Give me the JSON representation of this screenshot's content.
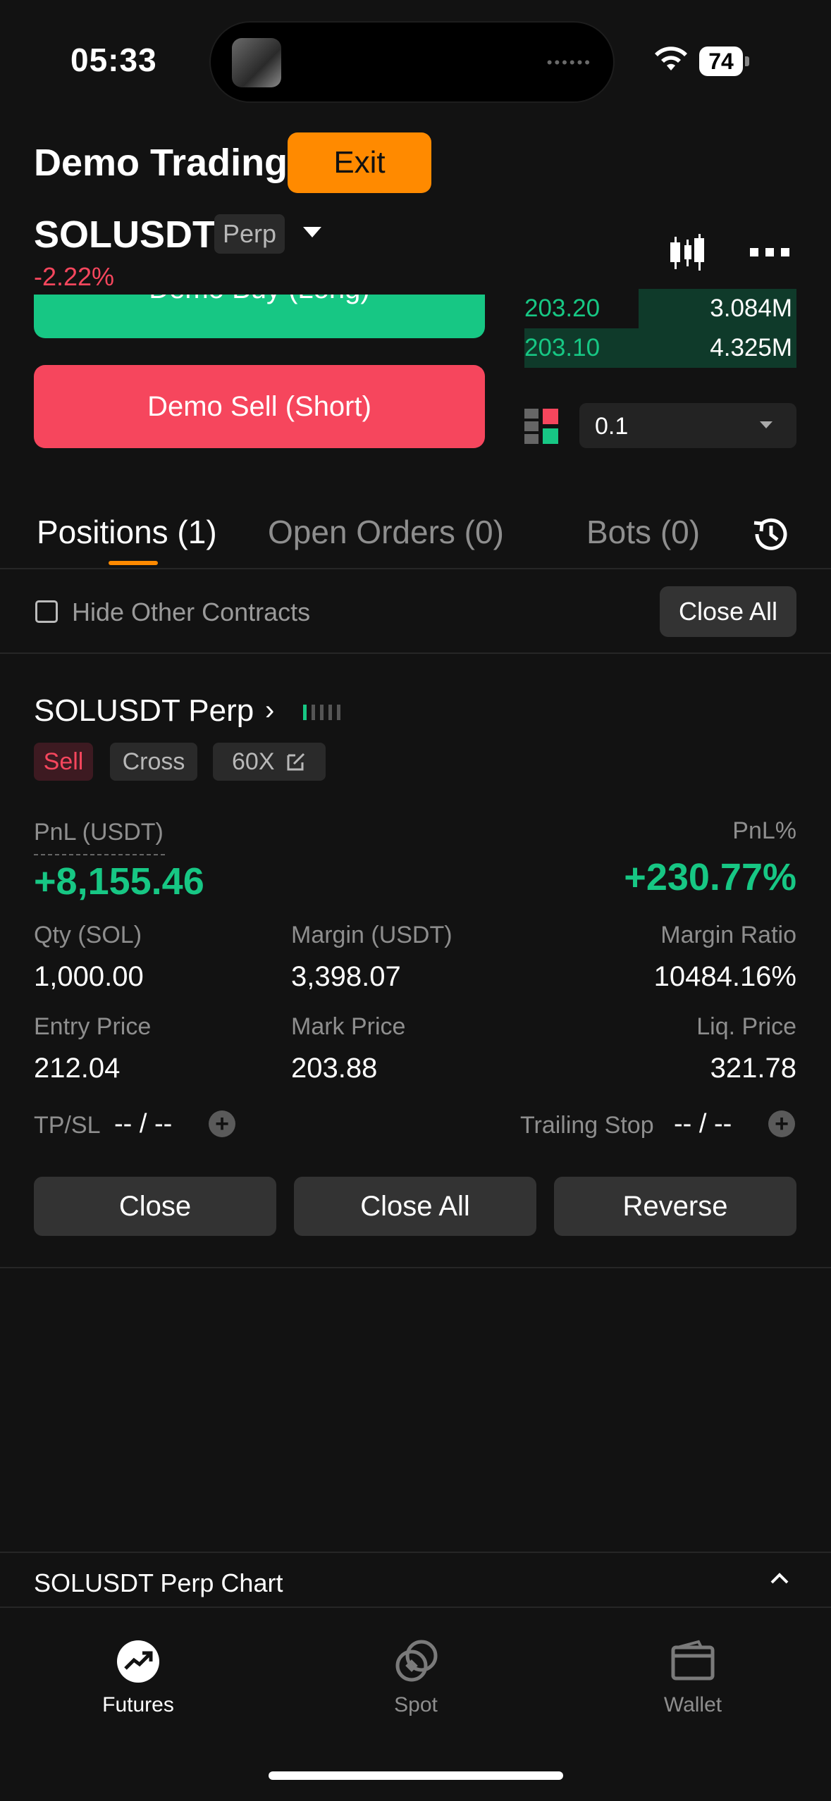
{
  "status_bar": {
    "time": "05:33",
    "battery": "74"
  },
  "header": {
    "title": "Demo Trading",
    "exit_label": "Exit"
  },
  "instrument": {
    "symbol": "SOLUSDT",
    "type_tag": "Perp",
    "change": "-2.22%"
  },
  "trade": {
    "buy_label": "Demo Buy (Long)",
    "sell_label": "Demo Sell (Short)",
    "size_value": "0.1"
  },
  "order_book": [
    {
      "price": "203.20",
      "qty": "3.084M",
      "depth": 0.58
    },
    {
      "price": "203.10",
      "qty": "4.325M",
      "depth": 1.0
    }
  ],
  "tabs": [
    {
      "label": "Positions (1)",
      "active": true
    },
    {
      "label": "Open Orders (0)",
      "active": false
    },
    {
      "label": "Bots (0)",
      "active": false
    }
  ],
  "filter": {
    "hide_label": "Hide Other Contracts",
    "close_all_label": "Close All"
  },
  "position": {
    "title": "SOLUSDT Perp",
    "side": "Sell",
    "margin_mode": "Cross",
    "leverage": "60X",
    "pnl_label": "PnL (USDT)",
    "pnl_value": "+8,155.46",
    "pnl_pct_label": "PnL%",
    "pnl_pct_value": "+230.77%",
    "qty_label": "Qty (SOL)",
    "qty_value": "1,000.00",
    "margin_label": "Margin (USDT)",
    "margin_value": "3,398.07",
    "margin_ratio_label": "Margin Ratio",
    "margin_ratio_value": "10484.16%",
    "entry_label": "Entry Price",
    "entry_value": "212.04",
    "mark_label": "Mark Price",
    "mark_value": "203.88",
    "liq_label": "Liq. Price",
    "liq_value": "321.78",
    "tpsl_label": "TP/SL",
    "tpsl_value": "-- / --",
    "trailing_label": "Trailing Stop",
    "trailing_value": "-- / --",
    "actions": {
      "close": "Close",
      "close_all": "Close All",
      "reverse": "Reverse"
    }
  },
  "chart_bar": {
    "title": "SOLUSDT Perp Chart"
  },
  "nav": [
    {
      "label": "Futures",
      "icon": "futures-icon",
      "active": true
    },
    {
      "label": "Spot",
      "icon": "spot-icon",
      "active": false
    },
    {
      "label": "Wallet",
      "icon": "wallet-icon",
      "active": false
    }
  ],
  "colors": {
    "accent": "#ff8a00",
    "buy": "#17c784",
    "sell": "#f6465d",
    "liq": "#ff8a1f"
  }
}
